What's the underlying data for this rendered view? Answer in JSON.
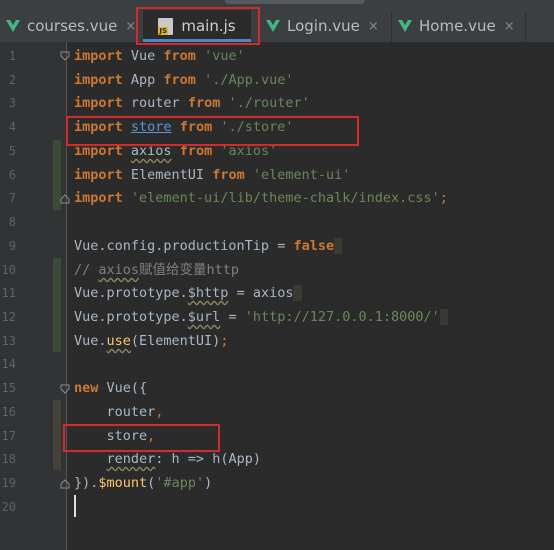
{
  "tabs": [
    {
      "label": "courses.vue",
      "close": "×",
      "icon": "vue-icon"
    },
    {
      "label": "main.js",
      "icon": "js-file-icon",
      "icon_text": "JS",
      "active": true
    },
    {
      "label": "Login.vue",
      "close": "×",
      "icon": "vue-icon"
    },
    {
      "label": "Home.vue",
      "close": "×",
      "icon": "vue-icon"
    }
  ],
  "line_numbers": [
    "1",
    "2",
    "3",
    "4",
    "5",
    "6",
    "7",
    "8",
    "9",
    "10",
    "11",
    "12",
    "13",
    "14",
    "15",
    "16",
    "17",
    "18",
    "19",
    "20"
  ],
  "code": {
    "l1": {
      "kw1": "import",
      "id": " Vue ",
      "kw2": "from",
      "str": " 'vue'"
    },
    "l2": {
      "kw1": "import",
      "id": " App ",
      "kw2": "from",
      "str": " './App.vue'"
    },
    "l3": {
      "kw1": "import",
      "id": " router ",
      "kw2": "from",
      "str": " './router'"
    },
    "l4": {
      "kw1": "import",
      "id": "store",
      "kw2": "from",
      "str": " './store'"
    },
    "l5": {
      "kw1": "import",
      "id": "axios",
      "kw2": "from",
      "str": " 'axios'"
    },
    "l6": {
      "kw1": "import",
      "id": " ElementUI ",
      "kw2": "from",
      "str": " 'element-ui'"
    },
    "l7": {
      "kw1": "import",
      "str": " 'element-ui/lib/theme-chalk/index.css'",
      "semi": ";"
    },
    "l9": {
      "a": "Vue.config.productionTip = ",
      "kw": "false"
    },
    "l10": {
      "pre": "// ",
      "word": "axios",
      "rest": "赋值给变量http"
    },
    "l11": {
      "a": "Vue.prototype.",
      "prop": "$http",
      "b": " = axios"
    },
    "l12": {
      "a": "Vue.prototype.",
      "prop": "$url",
      "b": " = ",
      "str": "'http://127.0.0.1:8000/'"
    },
    "l13": {
      "a": "Vue.",
      "fn": "use",
      "b": "(ElementUI)",
      "semi": ";"
    },
    "l15": {
      "kw": "new",
      "b": " Vue({"
    },
    "l16": {
      "a": "    router",
      "semi": ","
    },
    "l17": {
      "a": "    store",
      "semi": ","
    },
    "l18": {
      "a": "    ",
      "word": "render",
      "b": ": h => h(App)"
    },
    "l19": {
      "a": "}).",
      "fn": "$mount",
      "b": "(",
      "str": "'#app'",
      "c": ")"
    }
  }
}
